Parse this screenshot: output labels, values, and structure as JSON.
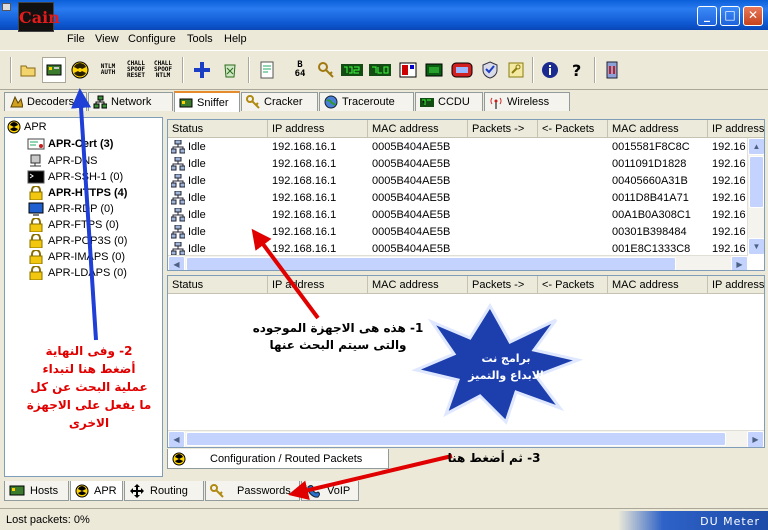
{
  "window": {
    "logo_text": "Cain",
    "buttons": {
      "minimize": "_",
      "maximize": "□",
      "close": "✕"
    }
  },
  "menu": [
    "File",
    "View",
    "Configure",
    "Tools",
    "Help"
  ],
  "toolbar": {
    "ntlm_auth": "NTLM AUTH",
    "chall_spoof_reset": "CHALL SPOOF RESET",
    "chall_spoof_ntlm": "CHALL SPOOF NTLM",
    "b64": "B 64"
  },
  "top_tabs": [
    "Decoders",
    "Network",
    "Sniffer",
    "Cracker",
    "Traceroute",
    "CCDU",
    "Wireless"
  ],
  "tree": {
    "root": "APR",
    "items": [
      {
        "label": "APR-Cert (3)",
        "bold": true
      },
      {
        "label": "APR-DNS",
        "bold": false
      },
      {
        "label": "APR-SSH-1 (0)",
        "bold": false
      },
      {
        "label": "APR-HTTPS (4)",
        "bold": true
      },
      {
        "label": "APR-RDP (0)",
        "bold": false
      },
      {
        "label": "APR-FTPS (0)",
        "bold": false
      },
      {
        "label": "APR-POP3S (0)",
        "bold": false
      },
      {
        "label": "APR-IMAPS (0)",
        "bold": false
      },
      {
        "label": "APR-LDAPS (0)",
        "bold": false
      }
    ]
  },
  "upper_table": {
    "columns": [
      "Status",
      "IP address",
      "MAC address",
      "Packets ->",
      "<- Packets",
      "MAC address",
      "IP address"
    ],
    "rows": [
      [
        "Idle",
        "192.168.16.1",
        "0005B404AE5B",
        "",
        "",
        "0015581F8C8C",
        "192.16"
      ],
      [
        "Idle",
        "192.168.16.1",
        "0005B404AE5B",
        "",
        "",
        "0011091D1828",
        "192.16"
      ],
      [
        "Idle",
        "192.168.16.1",
        "0005B404AE5B",
        "",
        "",
        "00405660A31B",
        "192.16"
      ],
      [
        "Idle",
        "192.168.16.1",
        "0005B404AE5B",
        "",
        "",
        "0011D8B41A71",
        "192.16"
      ],
      [
        "Idle",
        "192.168.16.1",
        "0005B404AE5B",
        "",
        "",
        "00A1B0A308C1",
        "192.16"
      ],
      [
        "Idle",
        "192.168.16.1",
        "0005B404AE5B",
        "",
        "",
        "00301B398484",
        "192.16"
      ],
      [
        "Idle",
        "192.168.16.1",
        "0005B404AE5B",
        "",
        "",
        "001E8C1333C8",
        "192.16"
      ]
    ]
  },
  "lower_table": {
    "columns": [
      "Status",
      "IP address",
      "MAC address",
      "Packets ->",
      "<- Packets",
      "MAC address",
      "IP address"
    ]
  },
  "config_tab": "Configuration / Routed Packets",
  "bottom_tabs": [
    "Hosts",
    "APR",
    "Routing",
    "Passwords",
    "VoIP"
  ],
  "status": {
    "lost_packets": "Lost packets:  0%",
    "meter": "DU Meter"
  },
  "annotations": {
    "note1_line1": "1- هذه هى الاجهزة الموجوده",
    "note1_line2": "والتى سيتم البحث عنها",
    "note2_line1": "2- وفى النهاية",
    "note2_line2": "أضغط هنا  لتبداء",
    "note2_line3": "عملية البحث عن كل",
    "note2_line4": "ما يفعل على الاجهزة",
    "note2_line5": "الاخرى",
    "note3": "3- ثم أضغط هنا",
    "star_line1": "برامج نت",
    "star_line2": "الابداع والتميز"
  },
  "colors": {
    "titlebar": "#0a5fd8",
    "annotation_red": "#e00000",
    "arrow_blue": "#1f3fd6",
    "star_fill": "#1d3fae"
  }
}
